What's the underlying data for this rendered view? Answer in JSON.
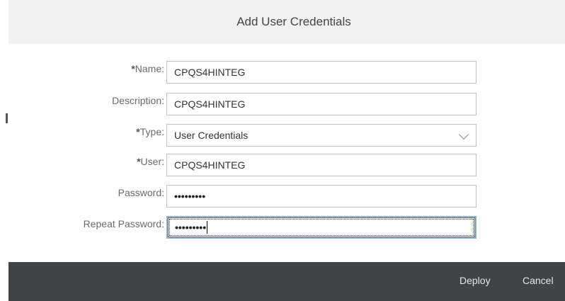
{
  "dialog": {
    "title": "Add User Credentials"
  },
  "form": {
    "name": {
      "required_mark": "*",
      "label": "Name:",
      "value": "CPQS4HINTEG"
    },
    "description": {
      "label": "Description:",
      "value": "CPQS4HINTEG"
    },
    "type": {
      "required_mark": "*",
      "label": "Type:",
      "selected": "User Credentials",
      "icon": "chevron-down-icon"
    },
    "user": {
      "required_mark": "*",
      "label": "User:",
      "value": "CPQS4HINTEG"
    },
    "password": {
      "label": "Password:",
      "masked_value": "•••••••••"
    },
    "repeat_password": {
      "label": "Repeat Password:",
      "masked_value": "•••••••••"
    }
  },
  "footer": {
    "deploy_label": "Deploy",
    "cancel_label": "Cancel"
  }
}
